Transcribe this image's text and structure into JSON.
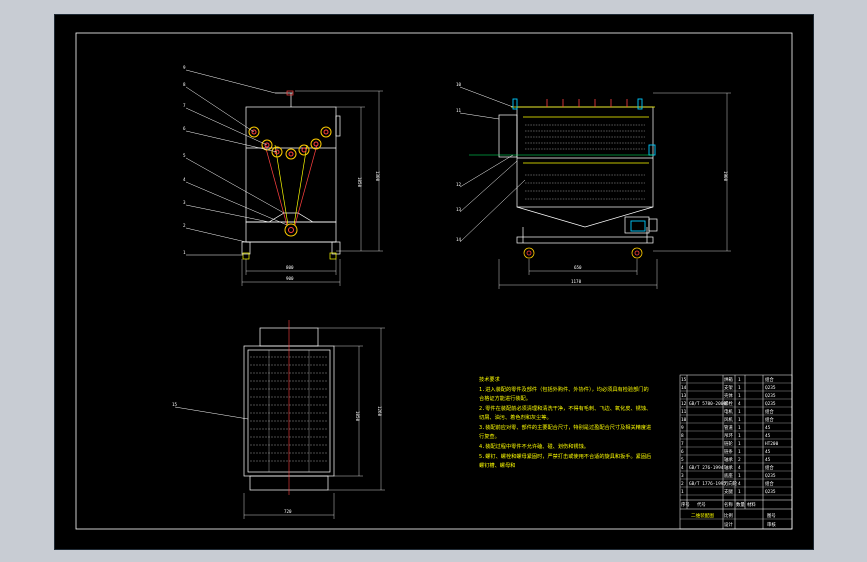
{
  "drawing": {
    "title_block_label": "二维装配图",
    "tech_notes_title": "技术要求",
    "tech_notes": [
      "1.进入装配的零件及部件（包括外购件、外协件），均必须具有检验部门的",
      "合格证方能进行装配。",
      "2.零件在装配前必须清理和清洗干净，不得有毛刺、飞边、氧化皮、锈蚀、",
      "切屑、油污、着色剂和灰尘等。",
      "3.装配前应对零、部件的主要配合尺寸，特别是过盈配合尺寸及相关精度进",
      "行复查。",
      "4.装配过程中零件不允许磕、碰、划伤和锈蚀。",
      "5.螺钉、螺栓和螺母紧固时，严禁打击或使用不合适的旋具和扳手。紧固后",
      "螺钉槽、螺母和"
    ],
    "front_view_balloons": [
      "9",
      "8",
      "7",
      "6",
      "5",
      "4",
      "3",
      "2",
      "1"
    ],
    "side_view_balloons": [
      "10",
      "11",
      "12",
      "13",
      "14"
    ],
    "top_view_balloons": [
      "15"
    ],
    "front_dims": {
      "height_inner": "1050",
      "height_total": "1300",
      "width_inner": "800",
      "width_total": "900"
    },
    "side_dims": {
      "height": "1900",
      "width_inner": "650",
      "width_total": "1170"
    },
    "top_dims": {
      "depth_inner": "1050",
      "depth_total": "1260",
      "width": "720"
    },
    "parts_list": [
      {
        "no": "15",
        "code": "",
        "qty": "1",
        "name": "烘箱",
        "mat": "组合"
      },
      {
        "no": "14",
        "code": "",
        "qty": "1",
        "name": "支架",
        "mat": "Q235"
      },
      {
        "no": "13",
        "code": "",
        "qty": "1",
        "name": "壳体",
        "mat": "Q235"
      },
      {
        "no": "12",
        "code": "GB/T 5780-2000",
        "qty": "4",
        "name": "螺栓",
        "mat": "Q235"
      },
      {
        "no": "11",
        "code": "",
        "qty": "1",
        "name": "电机",
        "mat": "组合"
      },
      {
        "no": "10",
        "code": "",
        "qty": "1",
        "name": "风机",
        "mat": "组合"
      },
      {
        "no": "9",
        "code": "",
        "qty": "1",
        "name": "管道",
        "mat": "45"
      },
      {
        "no": "8",
        "code": "",
        "qty": "1",
        "name": "吊环",
        "mat": "45"
      },
      {
        "no": "7",
        "code": "",
        "qty": "1",
        "name": "链轮",
        "mat": "HT200"
      },
      {
        "no": "6",
        "code": "",
        "qty": "1",
        "name": "链条",
        "mat": "45"
      },
      {
        "no": "5",
        "code": "",
        "qty": "2",
        "name": "轴承",
        "mat": "45"
      },
      {
        "no": "4",
        "code": "GB/T 276-1994",
        "qty": "4",
        "name": "轴承",
        "mat": "组合"
      },
      {
        "no": "3",
        "code": "",
        "qty": "1",
        "name": "底座",
        "mat": "Q235"
      },
      {
        "no": "2",
        "code": "GB/T 1776-1995",
        "qty": "4",
        "name": "万向轮",
        "mat": "组合"
      },
      {
        "no": "1",
        "code": "",
        "qty": "1",
        "name": "支腿",
        "mat": "Q235"
      }
    ],
    "parts_header": {
      "no": "序号",
      "code": "代号",
      "name": "名称",
      "qty": "数量",
      "mat": "材料"
    },
    "title_fields": {
      "scale": "比例",
      "sheet": "图号",
      "designer": "设计",
      "checker": "审核"
    }
  }
}
